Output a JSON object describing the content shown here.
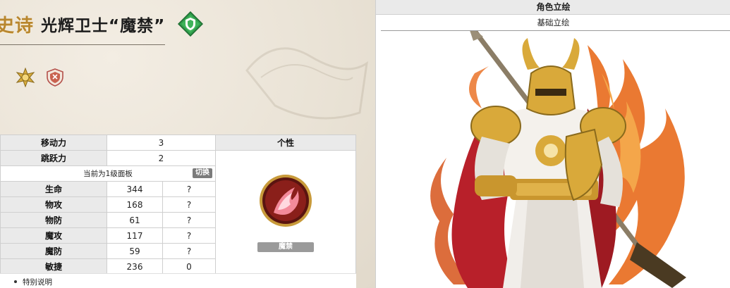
{
  "header": {
    "rarity": "史诗",
    "unit_name": "光辉卫士“魔禁”"
  },
  "icons": {
    "class": "shield-diamond-icon",
    "traits": [
      "gold-sun-badge-icon",
      "shield-crest-icon"
    ]
  },
  "stats": {
    "move": {
      "label": "移动力",
      "value": "3"
    },
    "jump": {
      "label": "跳跃力",
      "value": "2"
    },
    "panel_note": "当前为1级面板",
    "switch_label": "切换",
    "rows": [
      {
        "label": "生命",
        "value": "344",
        "extra": "?"
      },
      {
        "label": "物攻",
        "value": "168",
        "extra": "?"
      },
      {
        "label": "物防",
        "value": "61",
        "extra": "?"
      },
      {
        "label": "魔攻",
        "value": "117",
        "extra": "?"
      },
      {
        "label": "魔防",
        "value": "59",
        "extra": "?"
      },
      {
        "label": "敏捷",
        "value": "236",
        "extra": "0"
      }
    ]
  },
  "trait": {
    "header": "个性",
    "name": "魔禁",
    "icon": "flame-orb-icon"
  },
  "footnote": "特别说明",
  "portrait": {
    "header": "角色立绘",
    "tab": "基础立绘"
  },
  "colors": {
    "rarity_gold": "#b8862e",
    "header_gray": "#eaeaea",
    "tag_gray": "#9a9a9a",
    "armor_gold": "#d9a93a",
    "cape_red": "#b8202a",
    "flame_orange": "#e86a1c"
  }
}
